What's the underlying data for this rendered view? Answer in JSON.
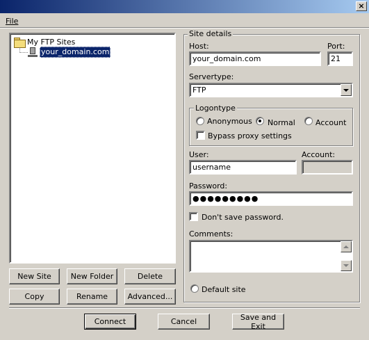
{
  "window": {
    "close_glyph": "×"
  },
  "menu": {
    "file": "File"
  },
  "tree": {
    "root": "My FTP Sites",
    "selected_site": "your_domain.com"
  },
  "left_buttons": {
    "new_site": "New Site",
    "new_folder": "New Folder",
    "delete": "Delete",
    "copy": "Copy",
    "rename": "Rename",
    "advanced": "Advanced..."
  },
  "site_details": {
    "group_title": "Site details",
    "host_label": "Host:",
    "host_value": "your_domain.com",
    "port_label": "Port:",
    "port_value": "21",
    "servertype_label": "Servertype:",
    "servertype_value": "FTP",
    "logontype": {
      "group_title": "Logontype",
      "anonymous": "Anonymous",
      "normal": "Normal",
      "account": "Account",
      "selected": "Normal",
      "bypass_proxy": "Bypass proxy settings",
      "bypass_proxy_checked": false
    },
    "user_label": "User:",
    "user_value": "username",
    "account_label": "Account:",
    "account_value": "",
    "password_label": "Password:",
    "password_value": "●●●●●●●●●",
    "dont_save_password": "Don't save password.",
    "dont_save_password_checked": false,
    "comments_label": "Comments:",
    "comments_value": "",
    "default_site": "Default site",
    "default_site_checked": false
  },
  "bottom_buttons": {
    "connect": "Connect",
    "cancel": "Cancel",
    "save_exit": "Save and Exit"
  }
}
